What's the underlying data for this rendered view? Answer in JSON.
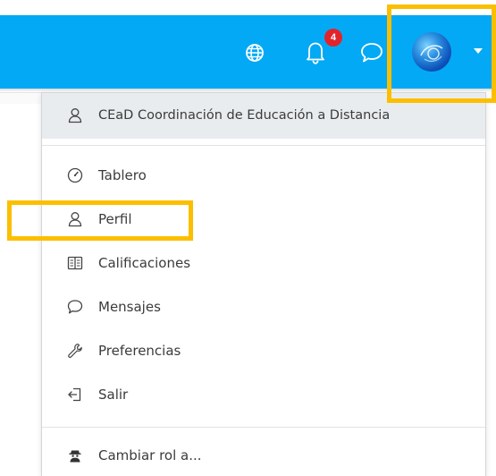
{
  "navbar": {
    "notifications": {
      "count": "4"
    },
    "icons": [
      "globe-icon",
      "bell-icon",
      "chat-icon",
      "avatar",
      "caret-down-icon"
    ],
    "color": "#03a9f4"
  },
  "user_menu": {
    "header_item": {
      "label": "CEaD Coordinación de Educación a Distancia",
      "icon": "user-icon"
    },
    "items": [
      {
        "label": "Tablero",
        "icon": "dashboard-icon"
      },
      {
        "label": "Perfil",
        "icon": "user-icon"
      },
      {
        "label": "Calificaciones",
        "icon": "grades-book-icon"
      },
      {
        "label": "Mensajes",
        "icon": "chat-icon"
      },
      {
        "label": "Preferencias",
        "icon": "wrench-icon"
      },
      {
        "label": "Salir",
        "icon": "logout-icon"
      }
    ],
    "footer_item": {
      "label": "Cambiar rol a...",
      "icon": "user-secret-icon"
    }
  },
  "highlight_color": "#fbbf00"
}
